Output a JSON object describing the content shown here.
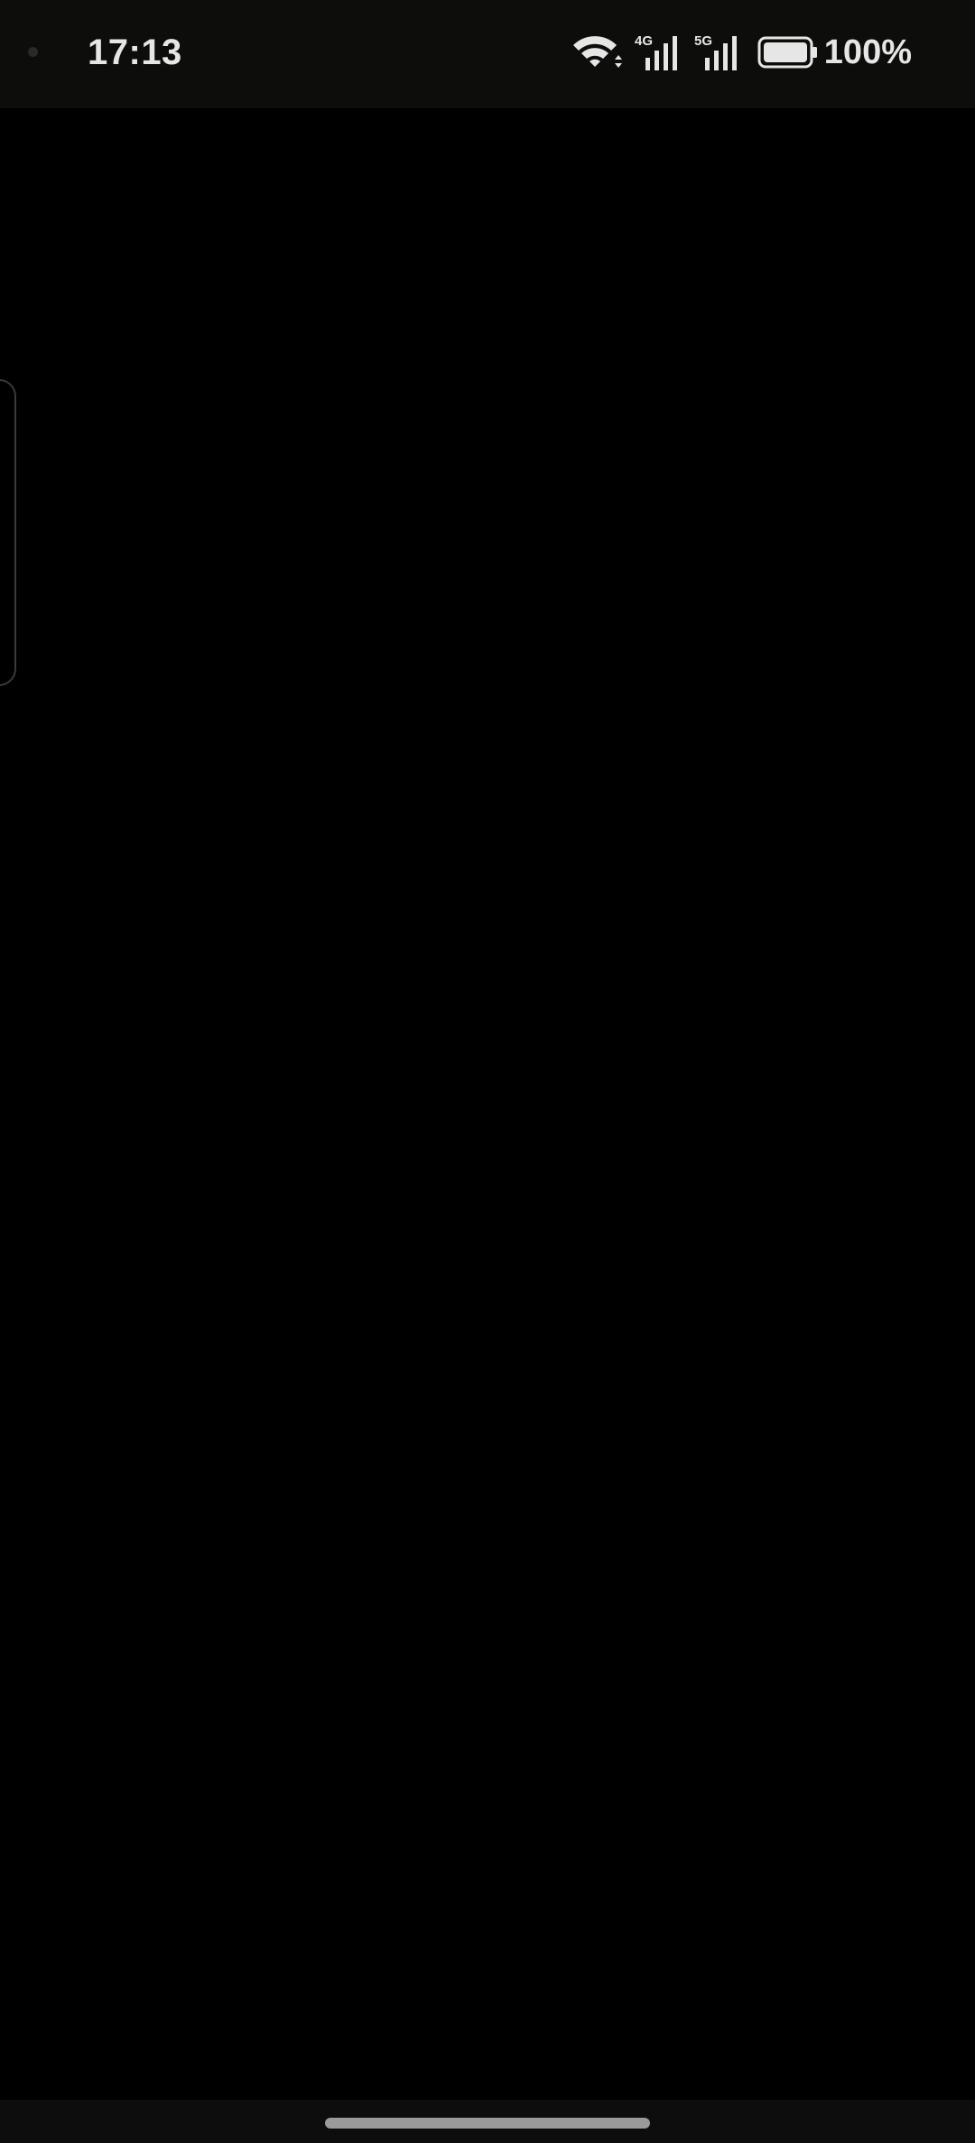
{
  "status_bar": {
    "time": "17:13",
    "network_1": "4G",
    "network_2": "5G",
    "battery_percent": "100%",
    "battery_level": 1.0,
    "icons": [
      "wifi-icon",
      "signal-4g-icon",
      "signal-5g-icon",
      "battery-icon"
    ]
  },
  "colors": {
    "background": "#000000",
    "status_bar": "#0d0d0b",
    "text": "#e6e6e6",
    "home_indicator": "#9a9a9a"
  }
}
